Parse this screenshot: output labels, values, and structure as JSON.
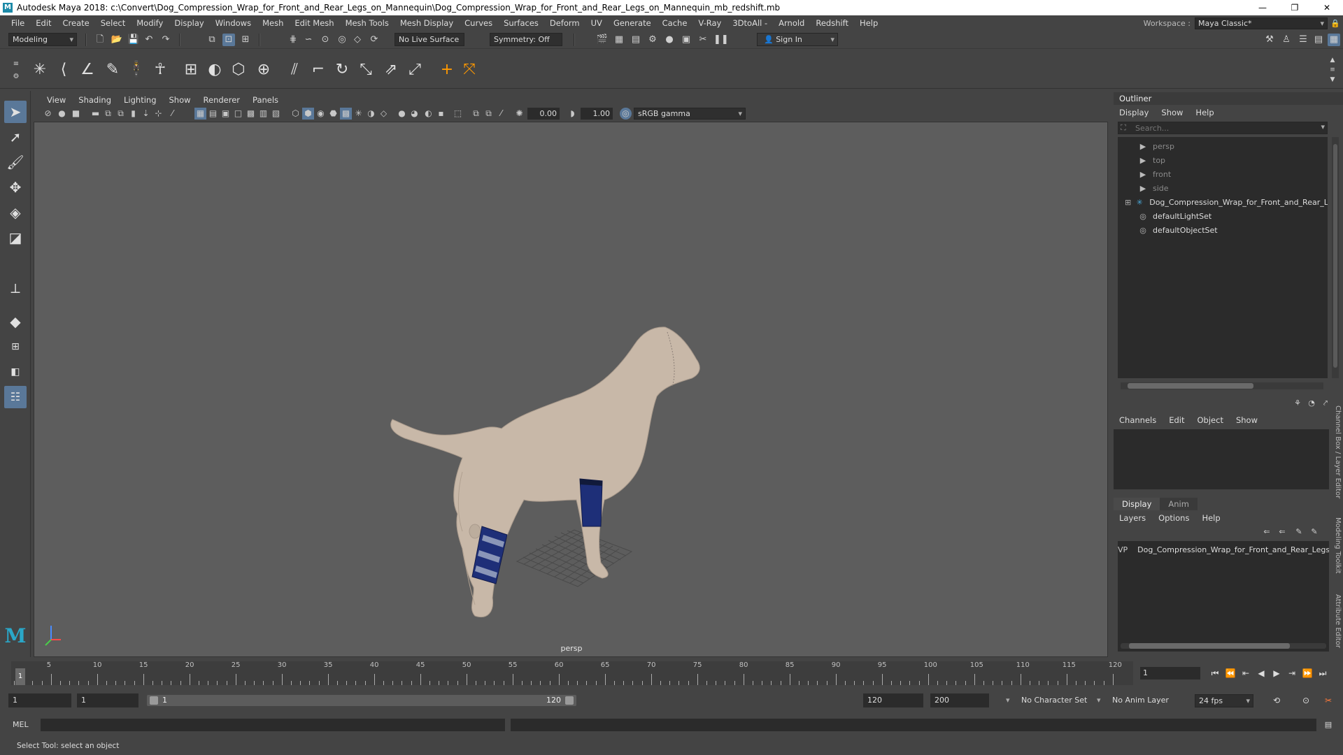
{
  "title_bar": {
    "text": "Autodesk Maya 2018: c:\\Convert\\Dog_Compression_Wrap_for_Front_and_Rear_Legs_on_Mannequin\\Dog_Compression_Wrap_for_Front_and_Rear_Legs_on_Mannequin_mb_redshift.mb",
    "app_icon": "M",
    "minimize": "—",
    "maximize": "❐",
    "close": "✕"
  },
  "menu": [
    "File",
    "Edit",
    "Create",
    "Select",
    "Modify",
    "Display",
    "Windows",
    "Mesh",
    "Edit Mesh",
    "Mesh Tools",
    "Mesh Display",
    "Curves",
    "Surfaces",
    "Deform",
    "UV",
    "Generate",
    "Cache",
    "V-Ray",
    "3DtoAll -",
    "Arnold",
    "Redshift",
    "Help"
  ],
  "workspace": {
    "label": "Workspace :",
    "value": "Maya Classic*"
  },
  "status_line": {
    "mode": "Modeling",
    "live_surface": "No Live Surface",
    "symmetry": "Symmetry: Off",
    "sign_in": "Sign In"
  },
  "viewport": {
    "menu": [
      "View",
      "Shading",
      "Lighting",
      "Show",
      "Renderer",
      "Panels"
    ],
    "exposure": "0.00",
    "gamma": "1.00",
    "color_space": "sRGB gamma",
    "camera": "persp"
  },
  "outliner": {
    "title": "Outliner",
    "menu": [
      "Display",
      "Show",
      "Help"
    ],
    "search_placeholder": "Search...",
    "items": [
      {
        "label": "persp",
        "icon": "camera-icon",
        "dim": true
      },
      {
        "label": "top",
        "icon": "camera-icon",
        "dim": true
      },
      {
        "label": "front",
        "icon": "camera-icon",
        "dim": true
      },
      {
        "label": "side",
        "icon": "camera-icon",
        "dim": true
      },
      {
        "label": "Dog_Compression_Wrap_for_Front_and_Rear_Legs",
        "icon": "group-icon",
        "dim": false
      },
      {
        "label": "defaultLightSet",
        "icon": "set-icon",
        "dim": false
      },
      {
        "label": "defaultObjectSet",
        "icon": "set-icon",
        "dim": false
      }
    ]
  },
  "channel_box": {
    "menu": [
      "Channels",
      "Edit",
      "Object",
      "Show"
    ]
  },
  "layer_editor": {
    "tabs": [
      "Display",
      "Anim"
    ],
    "menu": [
      "Layers",
      "Options",
      "Help"
    ],
    "layer": {
      "v": "V",
      "p": "P",
      "name": "Dog_Compression_Wrap_for_Front_and_Rear_Legs",
      "color": "#b0103a"
    }
  },
  "side_tabs": [
    "Channel Box / Layer Editor",
    "Modeling Toolkit",
    "Attribute Editor"
  ],
  "time_slider": {
    "ticks": [
      "5",
      "10",
      "15",
      "20",
      "25",
      "30",
      "35",
      "40",
      "45",
      "50",
      "55",
      "60",
      "65",
      "70",
      "75",
      "80",
      "85",
      "90",
      "95",
      "100",
      "105",
      "110",
      "115",
      "120"
    ],
    "current": "1",
    "current_field": "1"
  },
  "range_slider": {
    "start": "1",
    "playback_start": "1",
    "range_low": "1",
    "range_high": "120",
    "playback_end": "120",
    "end": "200",
    "character_set": "No Character Set",
    "anim_layer": "No Anim Layer",
    "fps": "24 fps"
  },
  "command_line": {
    "label": "MEL"
  },
  "help_line": "Select Tool: select an object"
}
